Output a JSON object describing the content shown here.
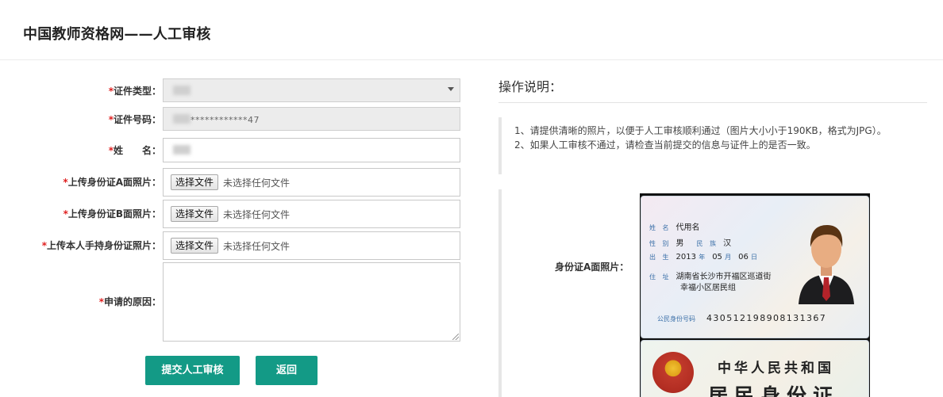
{
  "header": {
    "title": "中国教师资格网——人工审核"
  },
  "form": {
    "required_mark": "*",
    "cert_type": {
      "label": "证件类型：",
      "value": ""
    },
    "cert_number": {
      "label": "证件号码：",
      "value": "************47"
    },
    "name": {
      "label": "姓　　名：",
      "value": ""
    },
    "upload_a": {
      "label": "上传身份证A面照片：",
      "button": "选择文件",
      "status": "未选择任何文件"
    },
    "upload_b": {
      "label": "上传身份证B面照片：",
      "button": "选择文件",
      "status": "未选择任何文件"
    },
    "upload_hand": {
      "label": "上传本人手持身份证照片：",
      "button": "选择文件",
      "status": "未选择任何文件"
    },
    "reason": {
      "label": "申请的原因：",
      "value": ""
    },
    "submit_label": "提交人工审核",
    "back_label": "返回"
  },
  "instructions": {
    "title": "操作说明：",
    "lines": [
      "1、请提供清晰的照片，以便于人工审核顺利通过（图片大小小于190KB，格式为JPG）。",
      "2、如果人工审核不通过，请检查当前提交的信息与证件上的是否一致。"
    ]
  },
  "sample": {
    "label": "身份证A面照片：",
    "card_front": {
      "name_key": "姓 名",
      "name_value": "代用名",
      "gender_key": "性 别",
      "gender_value": "男",
      "ethnicity_key": "民 族",
      "ethnicity_value": "汉",
      "birth_key": "出 生",
      "birth_year": "2013",
      "year_unit": "年",
      "birth_month": "05",
      "month_unit": "月",
      "birth_day": "06",
      "day_unit": "日",
      "address_key": "住 址",
      "address_line1": "湖南省长沙市开福区巡道街",
      "address_line2": "幸福小区居民组",
      "id_key": "公民身份号码",
      "id_number": "430512198908131367"
    },
    "card_back": {
      "title1": "中华人民共和国",
      "title2": "居民身份证"
    }
  },
  "colors": {
    "primary": "#139a86",
    "required": "#e02020"
  }
}
